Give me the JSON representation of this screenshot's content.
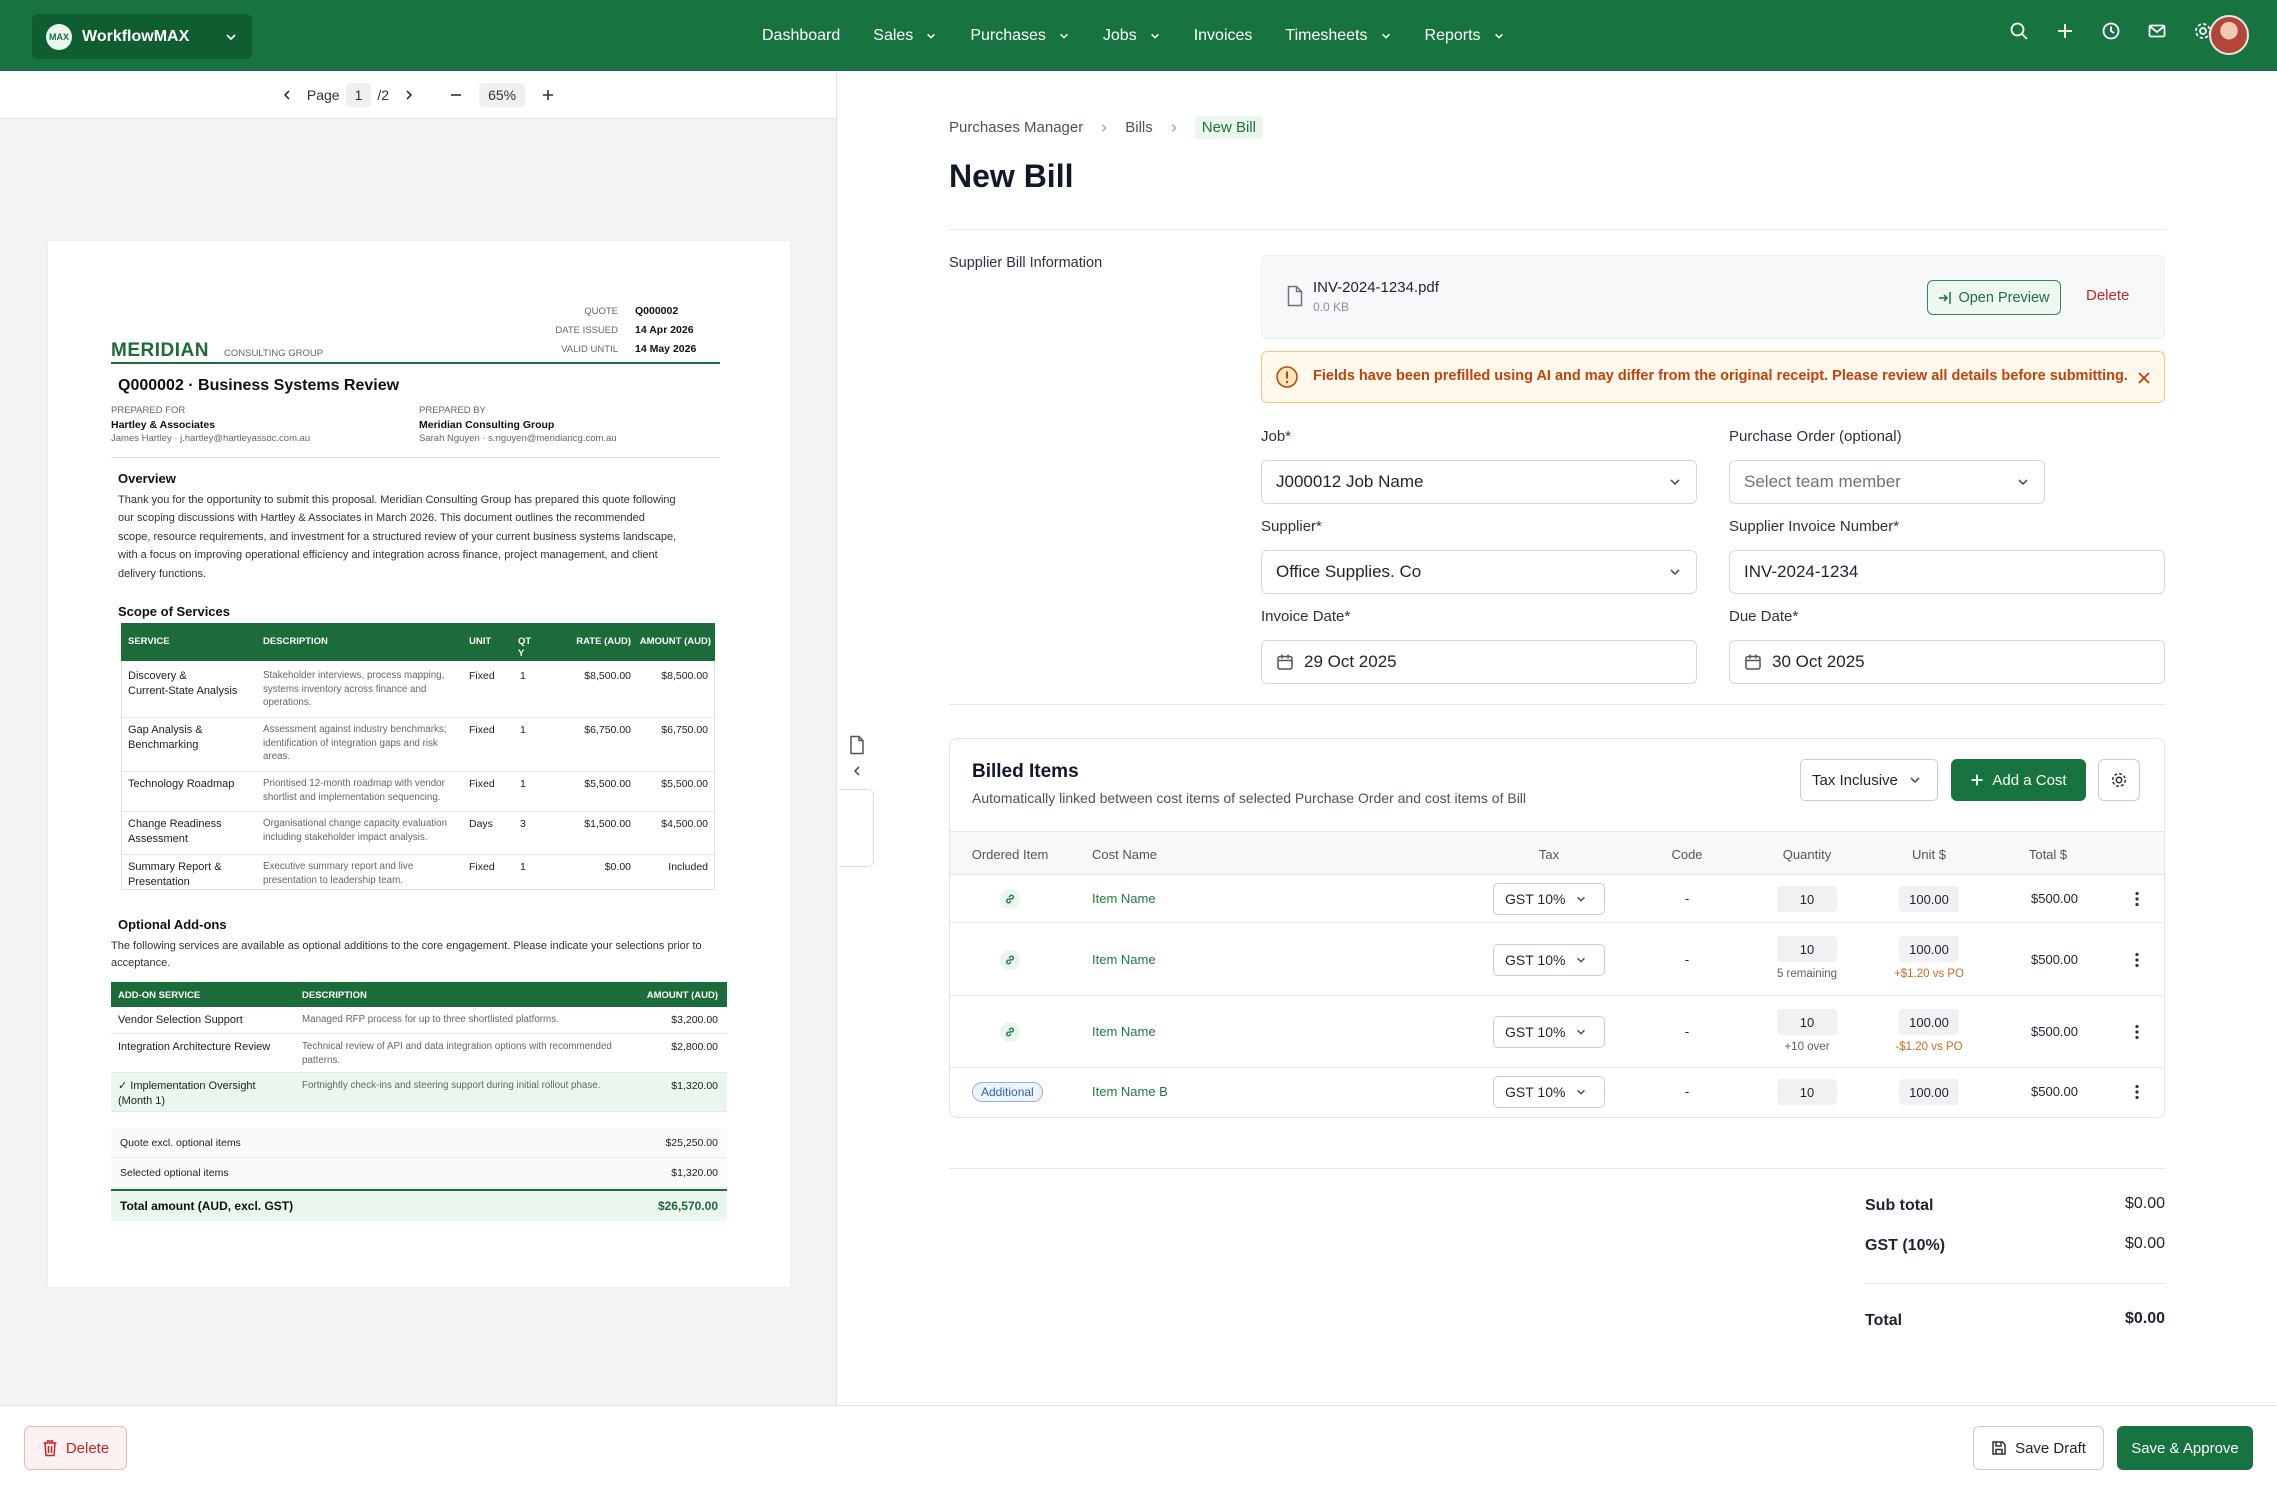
{
  "app": {
    "org_name": "WorkflowMAX",
    "logo_text": "MAX"
  },
  "nav": [
    {
      "label": "Dashboard",
      "has_menu": false
    },
    {
      "label": "Sales",
      "has_menu": true
    },
    {
      "label": "Purchases",
      "has_menu": true
    },
    {
      "label": "Jobs",
      "has_menu": true
    },
    {
      "label": "Invoices",
      "has_menu": false
    },
    {
      "label": "Timesheets",
      "has_menu": true
    },
    {
      "label": "Reports",
      "has_menu": true
    }
  ],
  "header_icons": [
    "search-icon",
    "plus-icon",
    "clock-icon",
    "mail-icon",
    "gear-icon"
  ],
  "viewer": {
    "page_label": "Page",
    "page_current": "1",
    "page_total": "/2",
    "zoom": "65%"
  },
  "doc": {
    "brand": "MERIDIAN",
    "brand_sub": "CONSULTING GROUP",
    "meta": [
      {
        "k": "QUOTE",
        "v": "Q000002"
      },
      {
        "k": "DATE ISSUED",
        "v": "14 Apr 2026"
      },
      {
        "k": "VALID UNTIL",
        "v": "14 May 2026"
      }
    ],
    "title": "Q000002 · Business Systems Review",
    "prepared_for_label": "PREPARED FOR",
    "prepared_for_name": "Hartley & Associates",
    "prepared_for_contact": "James Hartley · j.hartley@hartleyassoc.com.au",
    "prepared_by_label": "PREPARED BY",
    "prepared_by_name": "Meridian Consulting Group",
    "prepared_by_contact": "Sarah Nguyen · s.nguyen@meridiancg.com.au",
    "overview_heading": "Overview",
    "overview_lines": [
      "Thank you for the opportunity to submit this proposal. Meridian Consulting Group has prepared this quote following",
      "our scoping discussions with Hartley & Associates in March 2026. This document outlines the recommended",
      "scope, resource requirements, and investment for a structured review of your current business systems landscape,",
      "with a focus on improving operational efficiency and integration across finance, project management, and client",
      "delivery functions."
    ],
    "scope_heading": "Scope of Services",
    "scope_cols": [
      "SERVICE",
      "DESCRIPTION",
      "UNIT",
      "QT",
      "RATE (AUD)",
      "AMOUNT (AUD)"
    ],
    "scope_cols_qty_tail": "Y",
    "scope_rows": [
      {
        "service": [
          "Discovery &",
          "Current-State Analysis"
        ],
        "desc": [
          "Stakeholder interviews, process mapping,",
          "systems inventory across finance and",
          "operations."
        ],
        "unit": "Fixed",
        "qty": "1",
        "rate": "$8,500.00",
        "amount": "$8,500.00"
      },
      {
        "service": [
          "Gap Analysis &",
          "Benchmarking"
        ],
        "desc": [
          "Assessment against industry benchmarks;",
          "identification of integration gaps and risk",
          "areas."
        ],
        "unit": "Fixed",
        "qty": "1",
        "rate": "$6,750.00",
        "amount": "$6,750.00"
      },
      {
        "service": [
          "Technology Roadmap"
        ],
        "desc": [
          "Prioritised 12-month roadmap with vendor",
          "shortlist and implementation sequencing."
        ],
        "unit": "Fixed",
        "qty": "1",
        "rate": "$5,500.00",
        "amount": "$5,500.00"
      },
      {
        "service": [
          "Change Readiness",
          "Assessment"
        ],
        "desc": [
          "Organisational change capacity evaluation",
          "including stakeholder impact analysis."
        ],
        "unit": "Days",
        "qty": "3",
        "rate": "$1,500.00",
        "amount": "$4,500.00"
      },
      {
        "service": [
          "Summary Report &",
          "Presentation"
        ],
        "desc": [
          "Executive summary report and live",
          "presentation to leadership team."
        ],
        "unit": "Fixed",
        "qty": "1",
        "rate": "$0.00",
        "amount": "Included"
      }
    ],
    "addons_heading": "Optional Add-ons",
    "addons_lines": [
      "The following services are available as optional additions to the core engagement. Please indicate your selections prior to",
      "acceptance."
    ],
    "addons_cols": [
      "ADD-ON SERVICE",
      "DESCRIPTION",
      "AMOUNT (AUD)"
    ],
    "addons_rows": [
      {
        "service": [
          "Vendor Selection Support"
        ],
        "desc": [
          "Managed RFP process for up to three shortlisted platforms."
        ],
        "amount": "$3,200.00",
        "selected": false
      },
      {
        "service": [
          "Integration Architecture Review"
        ],
        "desc": [
          "Technical review of API and data integration options with recommended",
          "patterns."
        ],
        "amount": "$2,800.00",
        "selected": false
      },
      {
        "service": [
          "✓ Implementation Oversight",
          "(Month 1)"
        ],
        "desc": [
          "Fortnightly check-ins and steering support during initial rollout phase."
        ],
        "amount": "$1,320.00",
        "selected": true
      }
    ],
    "totals": [
      {
        "label": "Quote excl. optional items",
        "value": "$25,250.00"
      },
      {
        "label": "Selected optional items",
        "value": "$1,320.00"
      }
    ],
    "grand_total_label": "Total amount (AUD, excl. GST)",
    "grand_total_value": "$26,570.00"
  },
  "breadcrumb": [
    "Purchases Manager",
    "Bills",
    "New Bill"
  ],
  "page_title": "New Bill",
  "section_label": "Supplier Bill Information",
  "file": {
    "name": "INV-2024-1234.pdf",
    "size": "0.0 KB",
    "open_label": "Open Preview",
    "delete_label": "Delete"
  },
  "alert": "Fields have been prefilled using AI and may differ from the original receipt. Please review all details before submitting.",
  "form": {
    "job_label": "Job*",
    "job_value": "J000012 Job Name",
    "po_label": "Purchase Order (optional)",
    "po_placeholder": "Select team member",
    "supplier_label": "Supplier*",
    "supplier_value": "Office Supplies. Co",
    "sin_label": "Supplier Invoice Number*",
    "sin_value": "INV-2024-1234",
    "invoice_date_label": "Invoice Date*",
    "invoice_date_value": "29 Oct 2025",
    "due_date_label": "Due Date*",
    "due_date_value": "30 Oct 2025"
  },
  "billed": {
    "title": "Billed Items",
    "subtitle": "Automatically linked between cost items of selected Purchase Order and cost items of Bill",
    "tax_mode": "Tax Inclusive",
    "add_cost": "Add a Cost",
    "columns": [
      "Ordered Item",
      "Cost Name",
      "Tax",
      "Code",
      "Quantity",
      "Unit $",
      "Total $"
    ],
    "rows": [
      {
        "ordered": "link",
        "name": "Item Name",
        "tax": "GST 10%",
        "code": "-",
        "qty": "10",
        "qty_note": "",
        "unit": "100.00",
        "unit_note": "",
        "total": "$500.00"
      },
      {
        "ordered": "link",
        "name": "Item Name",
        "tax": "GST 10%",
        "code": "-",
        "qty": "10",
        "qty_note": "5 remaining",
        "unit": "100.00",
        "unit_note": "+$1.20 vs PO",
        "total": "$500.00"
      },
      {
        "ordered": "link",
        "name": "Item Name",
        "tax": "GST 10%",
        "code": "-",
        "qty": "10",
        "qty_note": "+10 over",
        "unit": "100.00",
        "unit_note": "-$1.20 vs PO",
        "total": "$500.00"
      },
      {
        "ordered": "Additional",
        "name": "Item Name B",
        "tax": "GST 10%",
        "code": "-",
        "qty": "10",
        "qty_note": "",
        "unit": "100.00",
        "unit_note": "",
        "total": "$500.00"
      }
    ]
  },
  "summary": {
    "subtotal_label": "Sub total",
    "subtotal_value": "$0.00",
    "gst_label": "GST (10%)",
    "gst_value": "$0.00",
    "total_label": "Total",
    "total_value": "$0.00"
  },
  "footer": {
    "delete": "Delete",
    "save_draft": "Save Draft",
    "save_approve": "Save & Approve"
  },
  "colors": {
    "brand": "#17733f",
    "warning": "#c2410c",
    "danger": "#c62828"
  }
}
